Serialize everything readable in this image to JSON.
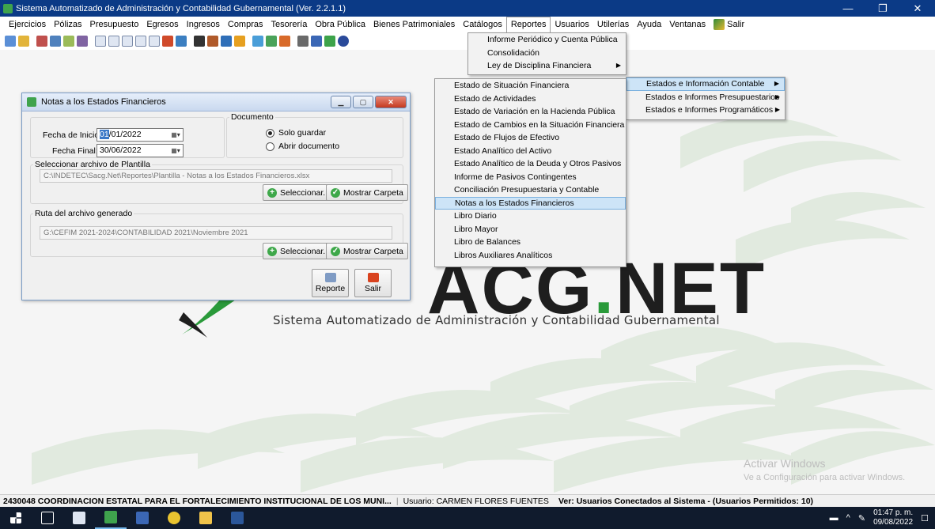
{
  "window": {
    "title": "Sistema Automatizado de Administración y Contabilidad Gubernamental  (Ver. 2.2.1.1)",
    "controls": [
      "—",
      "❐",
      "✕"
    ]
  },
  "menubar": [
    "Ejercicios",
    "Pólizas",
    "Presupuesto",
    "Egresos",
    "Ingresos",
    "Compras",
    "Tesorería",
    "Obra Pública",
    "Bienes Patrimoniales",
    "Catálogos",
    "Reportes",
    "Usuarios",
    "Utilerías",
    "Ayuda",
    "Ventanas",
    "Salir"
  ],
  "reportes_menu": [
    {
      "label": "Informe Periódico y Cuenta Pública",
      "submenu": false
    },
    {
      "label": "Consolidación",
      "submenu": false
    },
    {
      "label": "Ley de Disciplina Financiera",
      "submenu": true
    },
    {
      "label": "Estados e Información Contable",
      "submenu": true
    },
    {
      "label": "Estados e Informes Presupuestarios",
      "submenu": true
    },
    {
      "label": "Estados e Informes Programáticos",
      "submenu": true
    }
  ],
  "contable_menu": [
    "Estado de Situación Financiera",
    "Estado de Actividades",
    "Estado de Variación en la Hacienda Pública",
    "Estado de Cambios en la Situación Financiera",
    "Estado de Flujos de Efectivo",
    "Estado Analítico del Activo",
    "Estado Analítico de la Deuda y Otros Pasivos",
    "Informe de Pasivos Contingentes",
    "Conciliación Presupuestaria y Contable",
    "Notas a los Estados Financieros",
    "Libro Diario",
    "Libro Mayor",
    "Libro de Balances",
    "Libros Auxiliares Analíticos"
  ],
  "dialog": {
    "title": "Notas a los Estados Financieros",
    "fecha_inicio_label": "Fecha de Inicio:",
    "fecha_inicio_sel": "01",
    "fecha_inicio_rest": "/01/2022",
    "fecha_final_label": "Fecha Final:",
    "fecha_final": "30/06/2022",
    "documento_label": "Documento",
    "radio_solo": "Solo guardar",
    "radio_abrir": "Abrir documento",
    "plantilla_label": "Seleccionar archivo de Plantilla",
    "plantilla_path": "C:\\INDETEC\\Sacg.Net\\Reportes\\Plantilla - Notas a los Estados Financieros.xlsx",
    "ruta_label": "Ruta del archivo generado",
    "ruta_path": "G:\\CEFIM 2021-2024\\CONTABILIDAD 2021\\Noviembre 2021",
    "seleccionar": "Seleccionar...",
    "mostrar_carpeta": "Mostrar Carpeta",
    "reporte": "Reporte",
    "salir": "Salir"
  },
  "background": {
    "logo_text": "ACG",
    "logo_dot": ".",
    "logo_rest": "NET",
    "subtitle": "Sistema Automatizado de Administración y Contabilidad Gubernamental",
    "activate_1": "Activar Windows",
    "activate_2": "Ve a Configuración para activar Windows."
  },
  "statusbar": {
    "entity": "2430048 COORDINACION ESTATAL PARA EL FORTALECIMIENTO INSTITUCIONAL DE LOS MUNI...",
    "user": "Usuario: CARMEN FLORES FUENTES",
    "connected": "Ver: Usuarios Conectados al Sistema - (Usuarios Permitidos: 10)"
  },
  "taskbar": {
    "time": "01:47 p. m.",
    "date": "09/08/2022"
  },
  "colors": {
    "titlebar": "#0b3a86",
    "accent_green": "#2a9a3a",
    "menu_highlight": "#cde4f7"
  }
}
